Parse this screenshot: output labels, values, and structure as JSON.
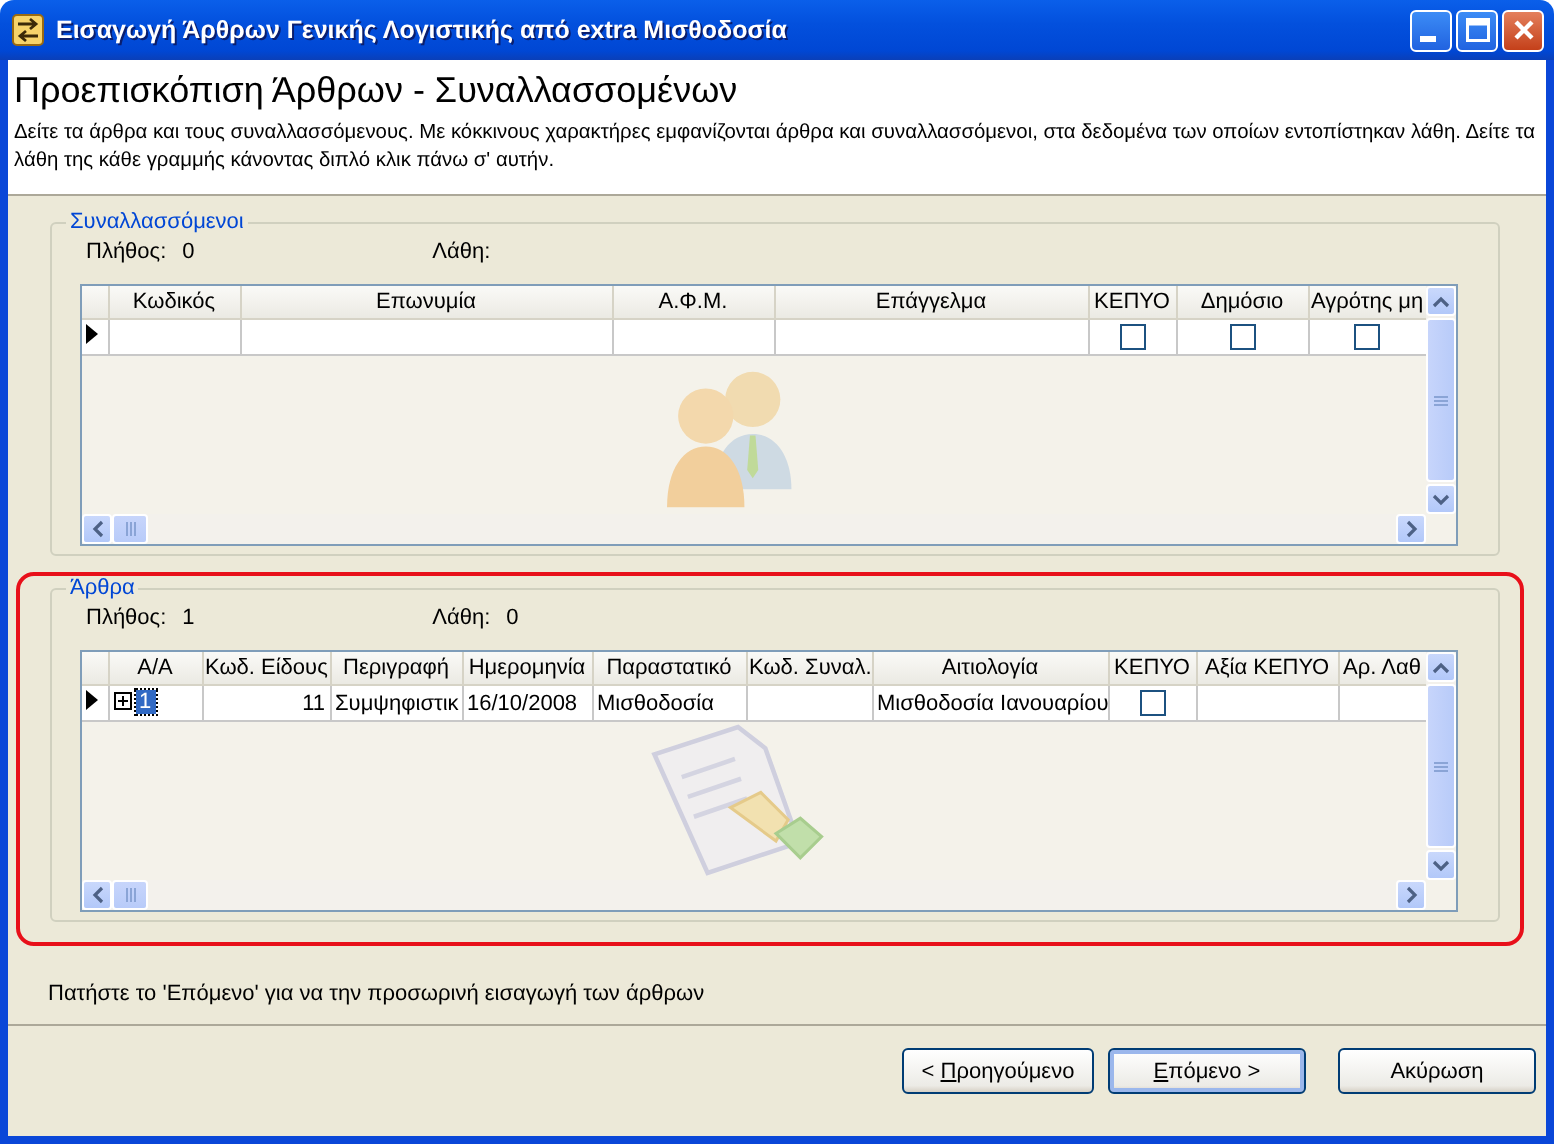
{
  "window": {
    "title": "Εισαγωγή Άρθρων Γενικής Λογιστικής από extra Μισθοδοσία"
  },
  "header": {
    "title": "Προεπισκόπιση Άρθρων - Συναλλασσομένων",
    "description": "Δείτε τα άρθρα και τους συναλλασσόμενους. Με κόκκινους χαρακτήρες εμφανίζονται άρθρα και συναλλασσόμενοι, στα δεδομένα των οποίων εντοπίστηκαν λάθη. Δείτε τα λάθη της κάθε γραμμής κάνοντας διπλό κλικ πάνω σ' αυτήν."
  },
  "groups": [
    {
      "legend": "Συναλλασσόμενοι",
      "highlighted": false,
      "count_label": "Πλήθος:",
      "count": "0",
      "errors_label": "Λάθη:",
      "watermark": {
        "kind": "people"
      },
      "columns": [
        "Κωδικός",
        "Επωνυμία",
        "Α.Φ.Μ.",
        "Επάγγελμα",
        "ΚΕΠΥΟ",
        "Δημόσιο",
        "Αγρότης μη"
      ],
      "rows": [
        {
          "current": true,
          "cells": [
            {
              "kind": "blank"
            },
            {
              "kind": "blank"
            },
            {
              "kind": "blank"
            },
            {
              "kind": "blank"
            },
            {
              "kind": "checkbox",
              "checked": false
            },
            {
              "kind": "checkbox",
              "checked": false
            },
            {
              "kind": "checkbox",
              "checked": false
            }
          ]
        }
      ]
    },
    {
      "legend": "Άρθρα",
      "highlighted": true,
      "count_label": "Πλήθος:",
      "count": "1",
      "errors_label": "Λάθη:",
      "errors": "0",
      "watermark": {
        "kind": "document"
      },
      "columns": [
        "Α/Α",
        "Κωδ. Είδους",
        "Περιγραφή",
        "Ημερομηνία",
        "Παραστατικό",
        "Κωδ. Συναλ.",
        "Αιτιολογία",
        "ΚΕΠΥΟ",
        "Αξία ΚΕΠΥΟ",
        "Αρ. Λαθ"
      ],
      "rows": [
        {
          "current": true,
          "cells": [
            {
              "kind": "expander",
              "text": "1",
              "selected": true
            },
            {
              "kind": "number",
              "text": "11"
            },
            {
              "kind": "text",
              "text": "Συμψηφιστικ"
            },
            {
              "kind": "text",
              "text": "16/10/2008"
            },
            {
              "kind": "text",
              "text": "Μισθοδοσία"
            },
            {
              "kind": "blank"
            },
            {
              "kind": "text",
              "text": "Μισθοδοσία Ιανουαρίου"
            },
            {
              "kind": "checkbox",
              "checked": false
            },
            {
              "kind": "blank"
            },
            {
              "kind": "blank"
            }
          ]
        }
      ]
    }
  ],
  "footer": {
    "note": "Πατήστε το 'Επόμενο' για να την προσωρινή εισαγωγή των άρθρων"
  },
  "buttons": [
    {
      "before": "< ",
      "accel": "Π",
      "after": "ροηγούμενο",
      "default": false
    },
    {
      "accel": "Ε",
      "after": "πόμενο >",
      "default": true
    },
    {
      "after": "Ακύρωση",
      "default": false
    }
  ]
}
